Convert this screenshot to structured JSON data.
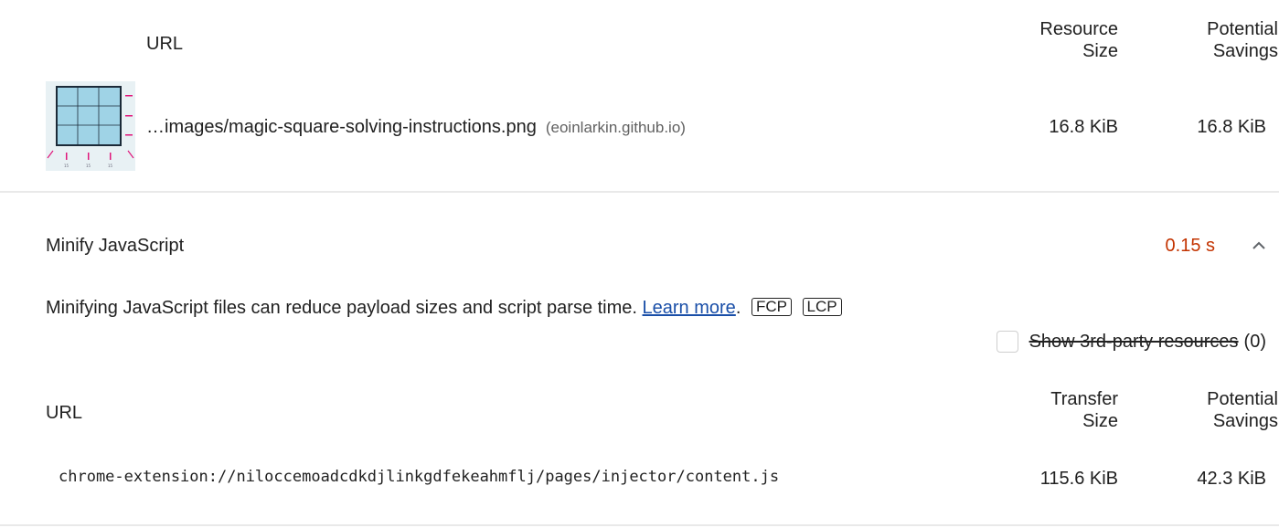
{
  "top_table": {
    "col_url": "URL",
    "col_resource_size": [
      "Resource",
      "Size"
    ],
    "col_potential_savings": [
      "Potential",
      "Savings"
    ],
    "row": {
      "thumbnail_icon": "image-thumbnail-icon",
      "url": "…images/magic-square-solving-instructions.png",
      "origin": "(eoinlarkin.github.io)",
      "resource_size": "16.8 KiB",
      "potential_savings": "16.8 KiB"
    }
  },
  "audit": {
    "title": "Minify JavaScript",
    "score": "0.15 s",
    "score_color": "#c33300",
    "description": "Minifying JavaScript files can reduce payload sizes and script parse time.",
    "learn_more": "Learn more",
    "tags": [
      "FCP",
      "LCP"
    ],
    "third_party_label": "Show 3rd-party resources",
    "third_party_count": "(0)",
    "table": {
      "col_url": "URL",
      "col_transfer_size": [
        "Transfer",
        "Size"
      ],
      "col_potential_savings": [
        "Potential",
        "Savings"
      ],
      "row": {
        "url": "chrome-extension://niloccemoadcdkdjlinkgdfekeahmflj/pages/injector/content.js",
        "transfer_size": "115.6 KiB",
        "potential_savings": "42.3 KiB"
      }
    }
  }
}
